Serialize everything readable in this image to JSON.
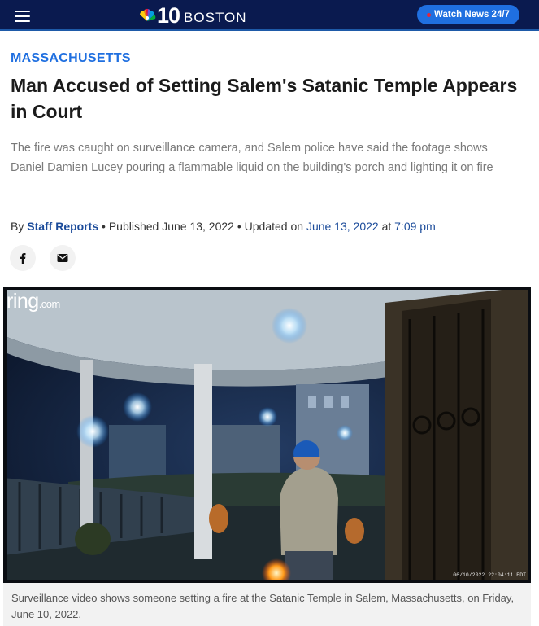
{
  "header": {
    "logo_number": "10",
    "logo_city": "BOSTON",
    "watch_label": "Watch News 24/7"
  },
  "article": {
    "section": "MASSACHUSETTS",
    "headline": "Man Accused of Setting Salem's Satanic Temple Appears in Court",
    "dek": "The fire was caught on surveillance camera, and Salem police have said the footage shows Daniel Damien Lucey pouring a flammable liquid on the building's porch and lighting it on fire",
    "byline": {
      "by": "By",
      "author": "Staff Reports",
      "published_label": "Published June 13, 2022",
      "updated_label": "Updated on",
      "updated_date": "June 13, 2022",
      "at": "at",
      "updated_time": "7:09 pm"
    }
  },
  "image": {
    "watermark": "ring",
    "watermark_suffix": ".com",
    "timestamp": "06/10/2022 22:04:11 EDT",
    "caption": "Surveillance video shows someone setting a fire at the Satanic Temple in Salem, Massachusetts, on Friday, June 10, 2022."
  },
  "colors": {
    "header_bg": "#0a1a4f",
    "accent": "#1f6fe0",
    "link": "#1b4b9a",
    "live_dot": "#e6263b"
  },
  "icons": [
    "menu-icon",
    "nbc-peacock-icon",
    "live-dot-icon",
    "facebook-icon",
    "email-icon"
  ]
}
